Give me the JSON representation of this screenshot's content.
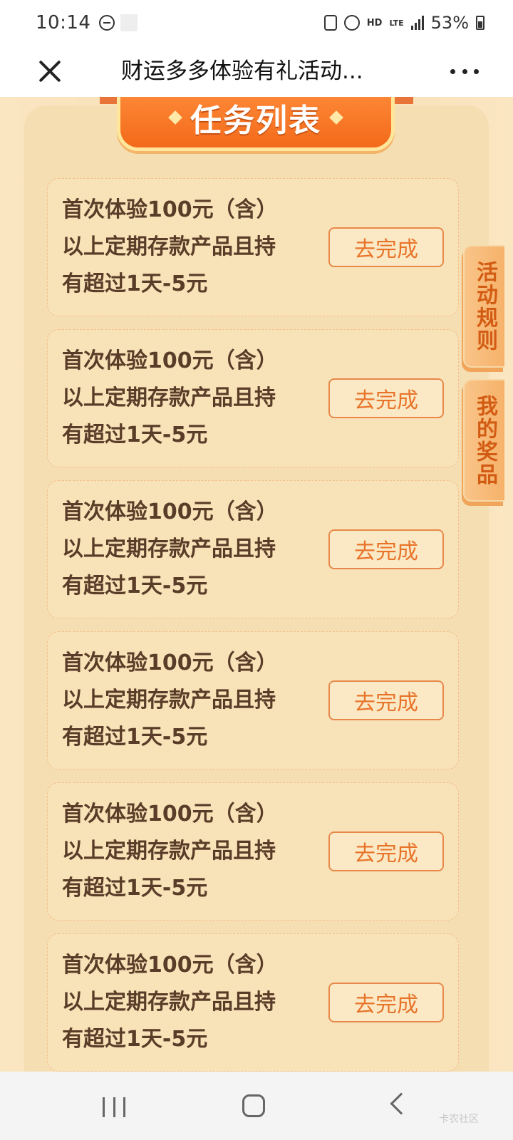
{
  "status_bar": {
    "time": "10:14",
    "hd": "HD",
    "lte": "LTE",
    "battery": "53%"
  },
  "nav": {
    "title": "财运多多体验有礼活动..."
  },
  "section": {
    "title": "任务列表"
  },
  "tasks": [
    {
      "line1": "首次体验100元（含）",
      "line2": "以上定期存款产品且持",
      "line3": "有超过1天-5元",
      "button": "去完成"
    },
    {
      "line1": "首次体验100元（含）",
      "line2": "以上定期存款产品且持",
      "line3": "有超过1天-5元",
      "button": "去完成"
    },
    {
      "line1": "首次体验100元（含）",
      "line2": "以上定期存款产品且持",
      "line3": "有超过1天-5元",
      "button": "去完成"
    },
    {
      "line1": "首次体验100元（含）",
      "line2": "以上定期存款产品且持",
      "line3": "有超过1天-5元",
      "button": "去完成"
    },
    {
      "line1": "首次体验100元（含）",
      "line2": "以上定期存款产品且持",
      "line3": "有超过1天-5元",
      "button": "去完成"
    },
    {
      "line1": "首次体验100元（含）",
      "line2": "以上定期存款产品且持",
      "line3": "有超过1天-5元",
      "button": "去完成"
    }
  ],
  "side_tabs": {
    "rules": "活动规则",
    "prizes": "我的奖品"
  },
  "watermark": "卡农社区",
  "colors": {
    "accent": "#f26a1a",
    "button_text": "#e8742a",
    "task_text": "#5a3d28",
    "background": "#f5e1b8"
  }
}
